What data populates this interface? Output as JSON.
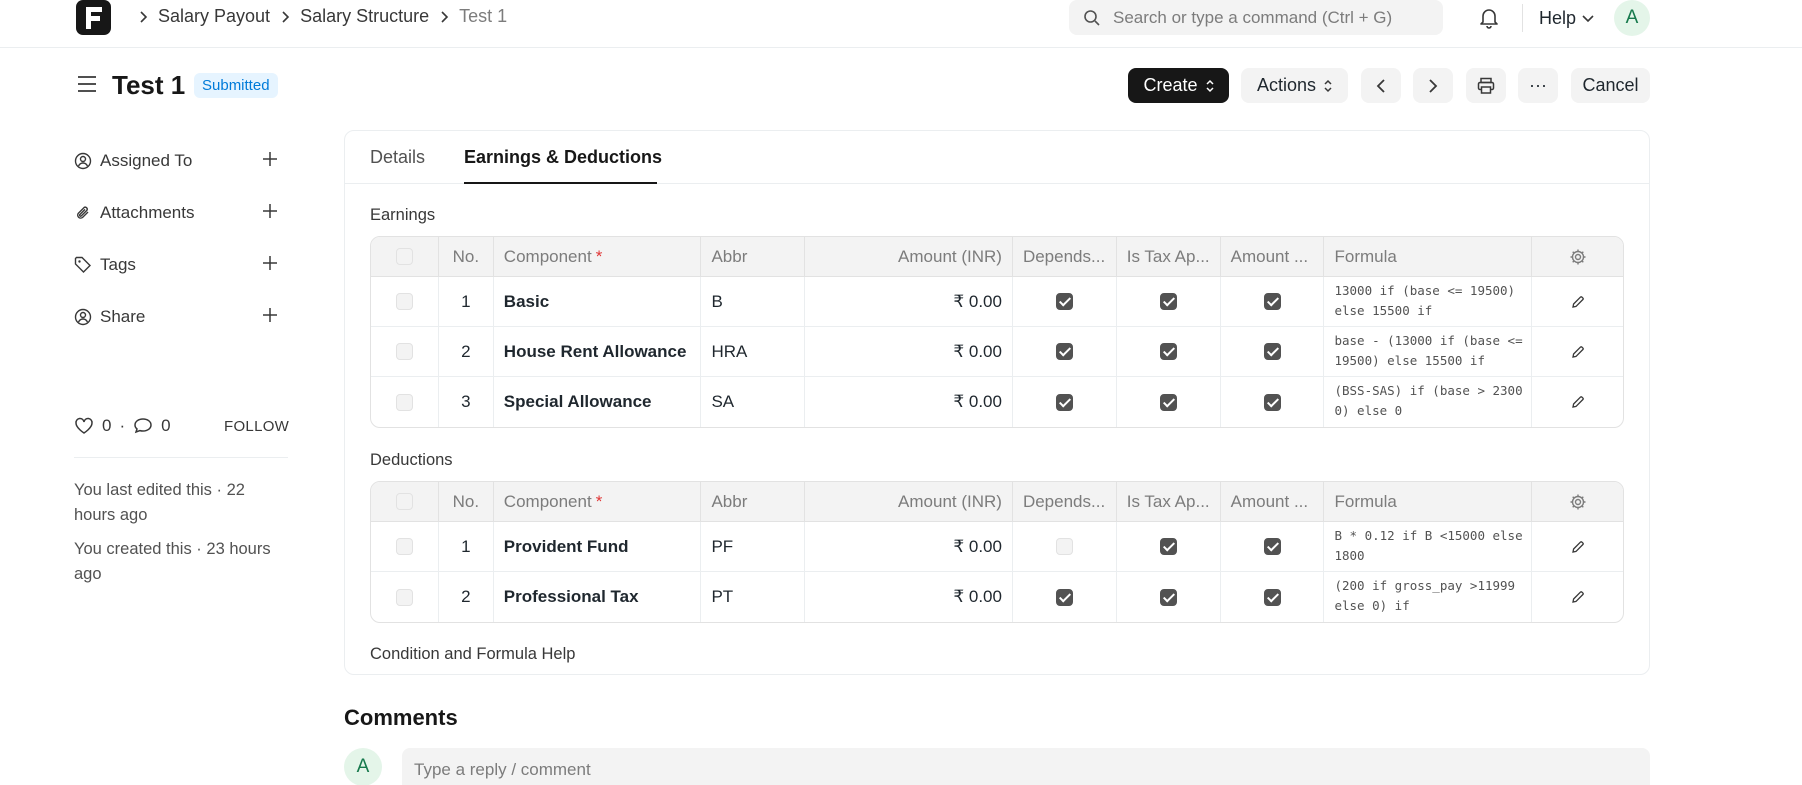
{
  "navbar": {
    "breadcrumbs": [
      "Salary Payout",
      "Salary Structure",
      "Test 1"
    ],
    "search_placeholder": "Search or type a command (Ctrl + G)",
    "help_label": "Help",
    "avatar_initial": "A"
  },
  "page": {
    "title": "Test 1",
    "status": "Submitted",
    "status_color": "#007bd9"
  },
  "toolbar": {
    "create_label": "Create",
    "actions_label": "Actions",
    "cancel_label": "Cancel",
    "more_label": "···"
  },
  "sidebar": {
    "assigned_to": "Assigned To",
    "attachments": "Attachments",
    "tags": "Tags",
    "share": "Share",
    "likes_count": "0",
    "comments_count": "0",
    "follow_label": "FOLLOW",
    "last_edited": "You last edited this · 22 hours ago",
    "created": "You created this · 23 hours ago"
  },
  "tabs": [
    {
      "label": "Details",
      "active": false
    },
    {
      "label": "Earnings & Deductions",
      "active": true
    }
  ],
  "columns": {
    "no": "No.",
    "component": "Component",
    "abbr": "Abbr",
    "amount": "Amount (INR)",
    "depends": "Depends...",
    "is_tax": "Is Tax Ap...",
    "amount_based": "Amount ...",
    "formula": "Formula"
  },
  "earnings": {
    "label": "Earnings",
    "rows": [
      {
        "no": "1",
        "component": "Basic",
        "abbr": "B",
        "amount": "₹ 0.00",
        "depends": true,
        "is_tax": true,
        "amount_based": true,
        "formula": "13000 if (base <= 19500) else 15500 if"
      },
      {
        "no": "2",
        "component": "House Rent Allowance",
        "abbr": "HRA",
        "amount": "₹ 0.00",
        "depends": true,
        "is_tax": true,
        "amount_based": true,
        "formula": "base - (13000 if (base <= 19500) else 15500 if"
      },
      {
        "no": "3",
        "component": "Special Allowance",
        "abbr": "SA",
        "amount": "₹ 0.00",
        "depends": true,
        "is_tax": true,
        "amount_based": true,
        "formula": "(BSS-SAS) if (base > 23000) else 0"
      }
    ]
  },
  "deductions": {
    "label": "Deductions",
    "rows": [
      {
        "no": "1",
        "component": "Provident Fund",
        "abbr": "PF",
        "amount": "₹ 0.00",
        "depends": false,
        "is_tax": true,
        "amount_based": true,
        "formula": "B * 0.12 if B <15000 else 1800"
      },
      {
        "no": "2",
        "component": "Professional Tax",
        "abbr": "PT",
        "amount": "₹ 0.00",
        "depends": true,
        "is_tax": true,
        "amount_based": true,
        "formula": "(200 if gross_pay >11999  else 0) if"
      }
    ]
  },
  "help_link": "Condition and Formula Help",
  "comments": {
    "title": "Comments",
    "placeholder": "Type a reply / comment",
    "avatar_initial": "A"
  }
}
